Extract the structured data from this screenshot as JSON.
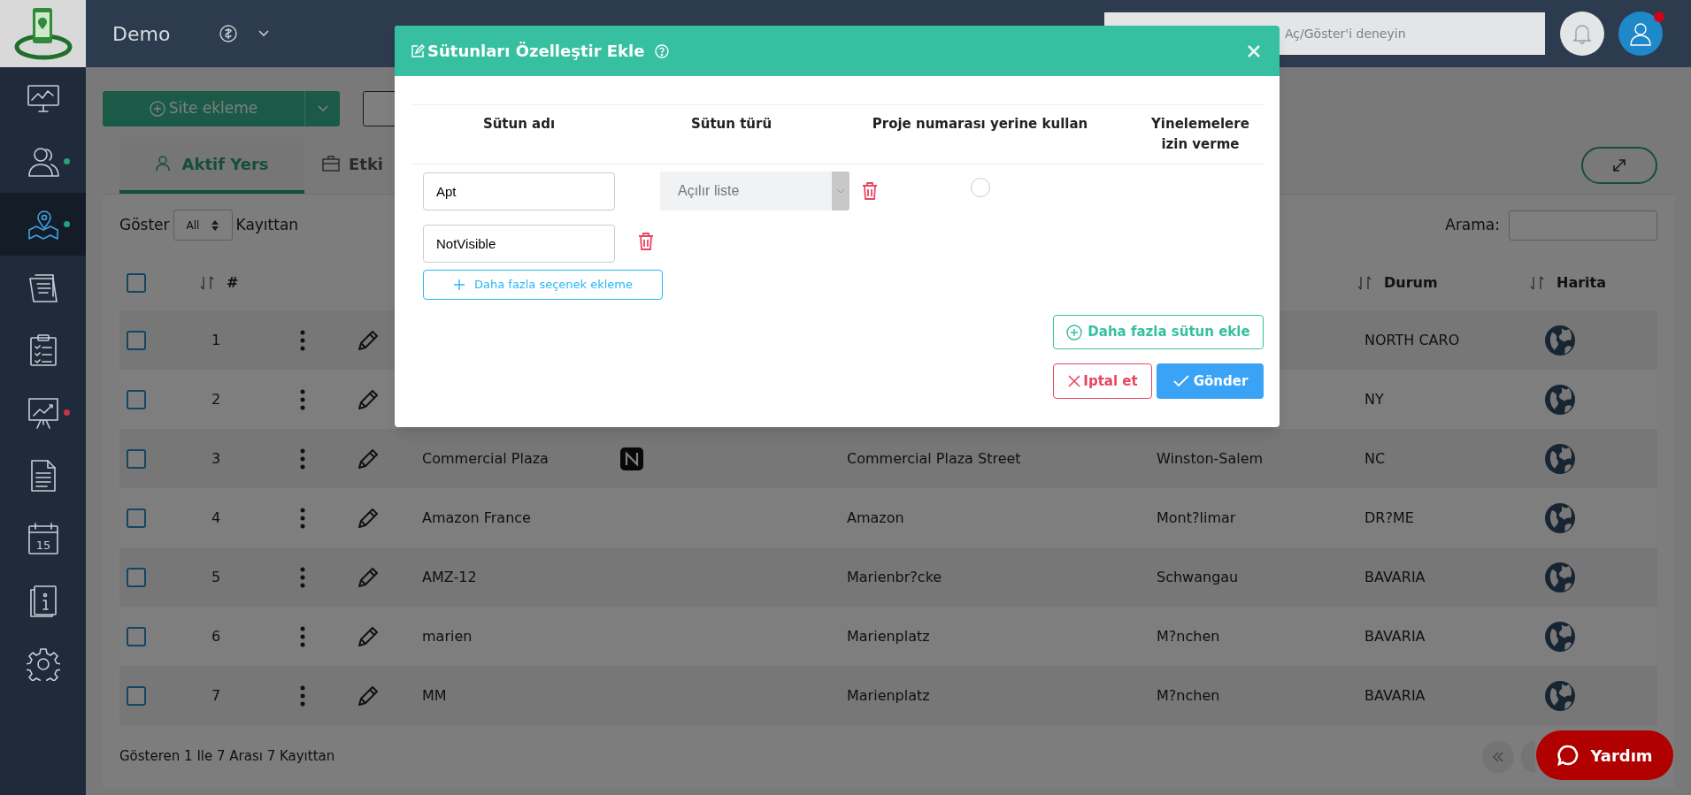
{
  "topbar": {
    "brand": "Demo",
    "search_placeholder": "Aç/Göster'i deneyin",
    "notification_dot": true
  },
  "sidebar": {
    "items": [
      {
        "kind": "monitor",
        "selected": false
      },
      {
        "kind": "users",
        "selected": false,
        "color": "#27a37b"
      },
      {
        "kind": "map",
        "selected": true,
        "color": "#27a37b"
      },
      {
        "kind": "notes",
        "selected": false
      },
      {
        "kind": "clipboard",
        "selected": false
      },
      {
        "kind": "presentation",
        "selected": false,
        "color": "#c8344e"
      },
      {
        "kind": "document",
        "selected": false
      },
      {
        "kind": "calendar",
        "selected": false,
        "label": "15"
      },
      {
        "kind": "book",
        "selected": false
      },
      {
        "kind": "gear",
        "selected": false
      }
    ]
  },
  "toolbar": {
    "add_button": "Site ekleme"
  },
  "tabs": [
    {
      "label": "Aktif Yers",
      "kind": "person",
      "selected": true
    },
    {
      "label": "Etki",
      "kind": "briefcase",
      "selected": false
    }
  ],
  "table_controls": {
    "show_label": "Göster",
    "page_size": "All",
    "records_label": "Kayıttan",
    "search_label": "Arama:"
  },
  "table": {
    "header": {
      "checked": false,
      "number": "#",
      "state": "Durum",
      "map": "Harita"
    },
    "rows": [
      {
        "checked": false,
        "number": "1",
        "state": "NORTH CARO"
      },
      {
        "checked": false,
        "number": "2",
        "state": "NY"
      },
      {
        "checked": false,
        "number": "3",
        "name": "Commercial Plaza",
        "nfc": true,
        "address": "Commercial Plaza Street",
        "city": "Winston-Salem",
        "state": "NC"
      },
      {
        "checked": false,
        "number": "4",
        "name": "Amazon France",
        "nfc": false,
        "address": "Amazon",
        "city": "Mont?limar",
        "state": "DR?ME"
      },
      {
        "checked": false,
        "number": "5",
        "name": "AMZ-12",
        "nfc": false,
        "address": "Marienbr?cke",
        "city": "Schwangau",
        "state": "BAVARIA"
      },
      {
        "checked": false,
        "number": "6",
        "name": "marien",
        "nfc": false,
        "address": "Marienplatz",
        "city": "M?nchen",
        "state": "BAVARIA"
      },
      {
        "checked": false,
        "number": "7",
        "name": "MM",
        "nfc": false,
        "address": "Marienplatz",
        "city": "M?nchen",
        "state": "BAVARIA"
      }
    ]
  },
  "footer": {
    "info": "Gösteren 1 Ile 7 Arası 7 Kayıttan"
  },
  "help_button": "Yardım",
  "modal": {
    "title": "Sütunları Özelleştir Ekle",
    "columns": [
      "Sütun adı",
      "Sütun türü",
      "Proje numarası yerine kullan",
      "Yinelemelere izin verme"
    ],
    "rows": [
      {
        "kind": "column",
        "value": "Apt",
        "type_placeholder": "Açılır liste",
        "project_number": false
      },
      {
        "kind": "option",
        "value": "NotVisible"
      }
    ],
    "add_option_button": "Daha fazla seçenek ekleme",
    "add_column_button": "Daha fazla sütun ekle",
    "cancel_button": "Iptal et",
    "submit_button": "Gönder"
  }
}
